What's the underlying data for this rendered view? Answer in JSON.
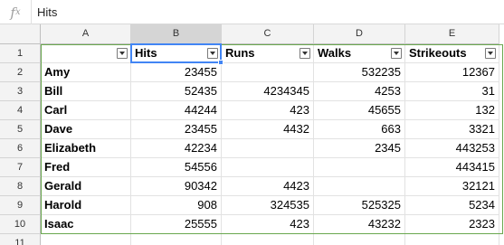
{
  "formula_bar": {
    "fx_label": "f",
    "fx_sub": "x",
    "value": "Hits"
  },
  "columns": [
    "A",
    "B",
    "C",
    "D",
    "E"
  ],
  "active_column": "B",
  "rows": [
    {
      "num": "1",
      "cells": [
        "",
        "Hits",
        "Runs",
        "Walks",
        "Strikeouts"
      ],
      "header": true
    },
    {
      "num": "2",
      "cells": [
        "Amy",
        "23455",
        "",
        "532235",
        "12367"
      ]
    },
    {
      "num": "3",
      "cells": [
        "Bill",
        "52435",
        "4234345",
        "4253",
        "31"
      ]
    },
    {
      "num": "4",
      "cells": [
        "Carl",
        "44244",
        "423",
        "45655",
        "132"
      ]
    },
    {
      "num": "5",
      "cells": [
        "Dave",
        "23455",
        "4432",
        "663",
        "3321"
      ]
    },
    {
      "num": "6",
      "cells": [
        "Elizabeth",
        "42234",
        "",
        "2345",
        "443253"
      ]
    },
    {
      "num": "7",
      "cells": [
        "Fred",
        "54556",
        "",
        "",
        "443415"
      ]
    },
    {
      "num": "8",
      "cells": [
        "Gerald",
        "90342",
        "4423",
        "",
        "32121"
      ]
    },
    {
      "num": "9",
      "cells": [
        "Harold",
        "908",
        "324535",
        "525325",
        "5234"
      ]
    },
    {
      "num": "10",
      "cells": [
        "Isaac",
        "25555",
        "423",
        "43232",
        "2323"
      ]
    },
    {
      "num": "11",
      "cells": [
        "",
        "",
        "",
        "",
        ""
      ]
    }
  ],
  "colors": {
    "selection": "#4285f4",
    "filter_range": "#6aa84f",
    "header_bg": "#f3f3f3",
    "active_header_bg": "#d5d5d5"
  },
  "icons": {
    "filter": "filter-dropdown-icon"
  }
}
